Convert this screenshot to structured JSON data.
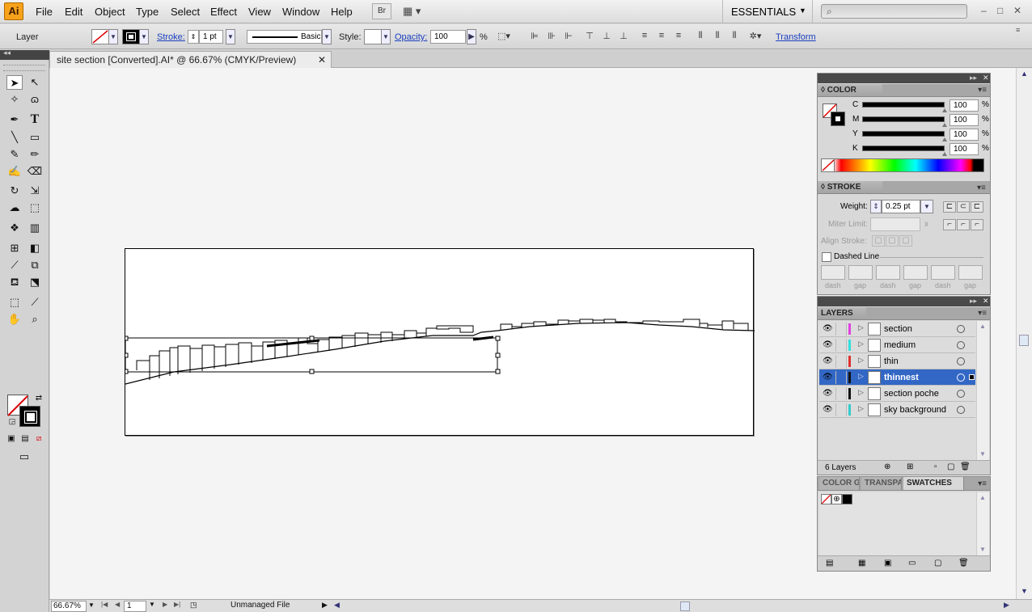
{
  "app": {
    "logo": "Ai"
  },
  "menu": [
    "File",
    "Edit",
    "Object",
    "Type",
    "Select",
    "Effect",
    "View",
    "Window",
    "Help"
  ],
  "bridge_label": "Br",
  "workspace": {
    "label": "ESSENTIALS"
  },
  "search": {
    "icon": "search-icon"
  },
  "window_controls": [
    "–",
    "□",
    "✕"
  ],
  "control_bar": {
    "selection_label": "Layer",
    "stroke_label": "Stroke:",
    "stroke_value": "1 pt",
    "brush_label": "Basic",
    "style_label": "Style:",
    "opacity_label": "Opacity:",
    "opacity_value": "100",
    "opacity_unit": "%",
    "transform_label": "Transform"
  },
  "document_tab": {
    "title": "site section [Converted].AI* @ 66.67% (CMYK/Preview)",
    "close": "✕"
  },
  "status_bar": {
    "zoom": "66.67%",
    "page": "1",
    "info": "Unmanaged File"
  },
  "color_panel": {
    "title": "COLOR",
    "channels": [
      {
        "label": "C",
        "value": "100",
        "unit": "%"
      },
      {
        "label": "M",
        "value": "100",
        "unit": "%"
      },
      {
        "label": "Y",
        "value": "100",
        "unit": "%"
      },
      {
        "label": "K",
        "value": "100",
        "unit": "%"
      }
    ]
  },
  "stroke_panel": {
    "title": "STROKE",
    "weight_label": "Weight:",
    "weight_value": "0.25 pt",
    "miter_label": "Miter Limit:",
    "miter_unit": "x",
    "align_label": "Align Stroke:",
    "dashed_label": "Dashed Line",
    "dash_labels": [
      "dash",
      "gap",
      "dash",
      "gap",
      "dash",
      "gap"
    ]
  },
  "layers_panel": {
    "title": "LAYERS",
    "count_label": "6 Layers",
    "layers": [
      {
        "name": "section",
        "color": "#e040e0",
        "active": false
      },
      {
        "name": "medium",
        "color": "#33dddd",
        "active": false
      },
      {
        "name": "thin",
        "color": "#e03030",
        "active": false
      },
      {
        "name": "thinnest",
        "color": "#111111",
        "active": true
      },
      {
        "name": "section poche",
        "color": "#111111",
        "active": false
      },
      {
        "name": "sky background",
        "color": "#33cccc",
        "active": false
      }
    ]
  },
  "swatches_panel": {
    "tabs": [
      "COLOR G",
      "TRANSPA",
      "SWATCHES"
    ],
    "active_tab": "SWATCHES"
  }
}
